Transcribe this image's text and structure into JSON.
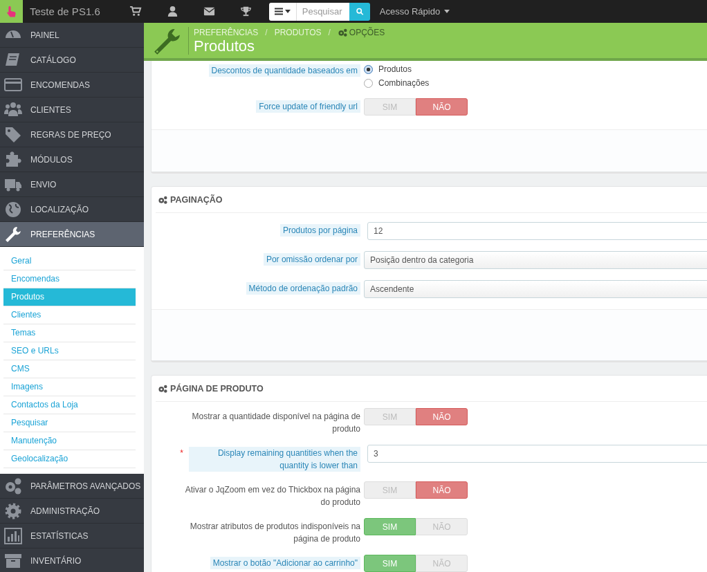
{
  "topbar": {
    "title": "Teste de PS1.6",
    "search": {
      "placeholder": "Pesquisar"
    },
    "quick_access": "Acesso Rápido"
  },
  "sidebar": {
    "items": [
      {
        "label": "PAINEL",
        "selected": false
      },
      {
        "label": "CATÁLOGO",
        "selected": false
      },
      {
        "label": "ENCOMENDAS",
        "selected": false
      },
      {
        "label": "CLIENTES",
        "selected": false
      },
      {
        "label": "REGRAS DE PREÇO",
        "selected": false
      },
      {
        "label": "MÓDULOS",
        "selected": false
      },
      {
        "label": "ENVIO",
        "selected": false
      },
      {
        "label": "LOCALIZAÇÃO",
        "selected": false
      },
      {
        "label": "PREFERÊNCIAS",
        "selected": true,
        "expanded": true,
        "children": [
          {
            "label": "Geral",
            "selected": false
          },
          {
            "label": "Encomendas",
            "selected": false
          },
          {
            "label": "Produtos",
            "selected": true
          },
          {
            "label": "Clientes",
            "selected": false
          },
          {
            "label": "Temas",
            "selected": false
          },
          {
            "label": "SEO e URLs",
            "selected": false
          },
          {
            "label": "CMS",
            "selected": false
          },
          {
            "label": "Imagens",
            "selected": false
          },
          {
            "label": "Contactos da Loja",
            "selected": false
          },
          {
            "label": "Pesquisar",
            "selected": false
          },
          {
            "label": "Manutenção",
            "selected": false
          },
          {
            "label": "Geolocalização",
            "selected": false
          }
        ]
      },
      {
        "label": "PARÂMETROS AVANÇADOS",
        "selected": false
      },
      {
        "label": "ADMINISTRAÇÃO",
        "selected": false
      },
      {
        "label": "ESTATÍSTICAS",
        "selected": false
      },
      {
        "label": "INVENTÁRIO",
        "selected": false
      }
    ]
  },
  "page_header": {
    "breadcrumb": [
      {
        "label": "PREFERÊNCIAS"
      },
      {
        "label": "PRODUTOS"
      },
      {
        "label": "OPÇÕES",
        "kind": "current"
      }
    ],
    "separator": "/",
    "title": "Produtos"
  },
  "panels": [
    {
      "rows": [
        {
          "kind": "radio",
          "label": "Descontos de quantidade baseados em",
          "hint": true,
          "options": [
            {
              "label": "Produtos",
              "selected": true
            },
            {
              "label": "Combinações",
              "selected": false
            }
          ]
        },
        {
          "kind": "switch",
          "label": "Force update of friendly url",
          "hint": true,
          "on": false,
          "yes": "SIM",
          "no": "NÃO"
        }
      ]
    },
    {
      "heading": "PAGINAÇÃO",
      "rows": [
        {
          "kind": "text",
          "label": "Produtos por página",
          "hint": true,
          "value": "12"
        },
        {
          "kind": "select",
          "label": "Por omissão ordenar por",
          "hint": true,
          "value": "Posição dentro da categoria"
        },
        {
          "kind": "select",
          "label": "Método de ordenação padrão",
          "hint": true,
          "value": "Ascendente"
        }
      ]
    },
    {
      "heading": "PÁGINA DE PRODUTO",
      "rows": [
        {
          "kind": "switch",
          "label": "Mostrar a quantidade disponível na página de produto",
          "hint": false,
          "on": false,
          "yes": "SIM",
          "no": "NÃO"
        },
        {
          "kind": "text",
          "label": "Display remaining quantities when the quantity is lower than",
          "hint": true,
          "required_mark": "*",
          "value": "3"
        },
        {
          "kind": "switch",
          "label": "Ativar o JqZoom em vez do Thickbox na página do produto",
          "hint": false,
          "on": false,
          "yes": "SIM",
          "no": "NÃO"
        },
        {
          "kind": "switch",
          "label": "Mostrar atributos de produtos indisponíveis na página de produto",
          "hint": false,
          "on": true,
          "yes": "SIM",
          "no": "NÃO"
        },
        {
          "kind": "switch",
          "label": "Mostrar o botão \"Adicionar ao carrinho\"",
          "hint": true,
          "on": true,
          "yes": "SIM",
          "no": "NÃO"
        }
      ]
    }
  ]
}
